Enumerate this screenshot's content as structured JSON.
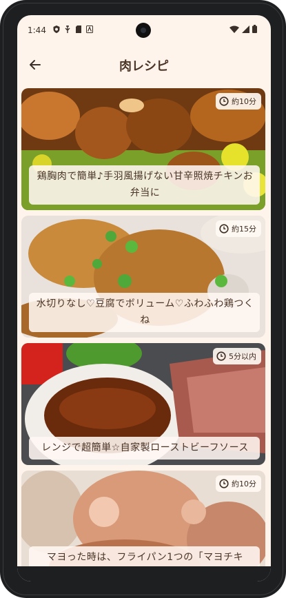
{
  "status_bar": {
    "time": "1:44"
  },
  "app_bar": {
    "title": "肉レシピ"
  },
  "recipes": [
    {
      "time": "約10分",
      "title": "鶏胸肉で簡単♪手羽風揚げない甘辛照焼チキンお弁当に"
    },
    {
      "time": "約15分",
      "title": "水切りなし♡豆腐でボリューム♡ふわふわ鶏つくね"
    },
    {
      "time": "5分以内",
      "title": "レンジで超簡単☆自家製ローストビーフソース"
    },
    {
      "time": "約10分",
      "title": "マヨった時は、フライパン1つの「マヨチキ"
    }
  ],
  "colors": {
    "background": "#fff4ec",
    "title_text": "#4a3426",
    "caption_bg": "#fff7f2"
  },
  "icons": {
    "back": "arrow-left-icon",
    "clock": "clock-icon"
  }
}
